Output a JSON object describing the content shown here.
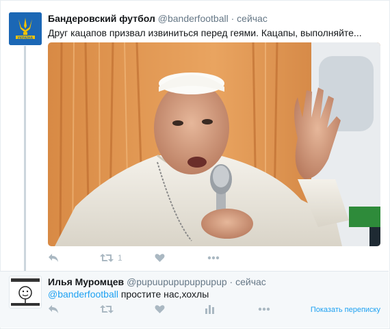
{
  "tweet1": {
    "name": "Бандеровский футбол",
    "handle": "@banderfootball",
    "separator": "·",
    "time": "сейчас",
    "text": "Друг кацапов призвал извиниться перед геями. Кацапы, выполняйте...",
    "retweet_count": "1",
    "avatar_text": "УКРАЇНА"
  },
  "tweet2": {
    "name": "Илья Муромцев",
    "handle": "@pupuupupupuppupup",
    "separator": "·",
    "time": "сейчас",
    "mention": "@banderfootball",
    "text": " простите нас,хохлы",
    "show_conversation": "Показать переписку"
  },
  "colors": {
    "accent": "#1da1f2",
    "icon": "#aab8c2",
    "avatar_bg": "#1b67b5",
    "avatar_gold": "#f2c200"
  },
  "icons": [
    "reply-icon",
    "retweet-icon",
    "like-icon",
    "more-icon",
    "analytics-icon"
  ]
}
